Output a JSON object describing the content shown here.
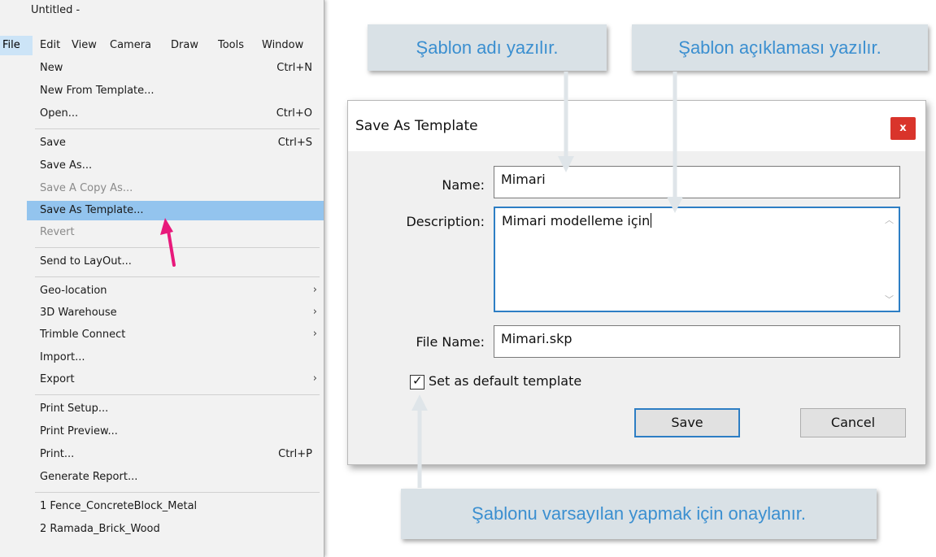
{
  "window": {
    "title": "Untitled -"
  },
  "menubar": [
    "File",
    "Edit",
    "View",
    "Camera",
    "Draw",
    "Tools",
    "Window"
  ],
  "file_menu": [
    {
      "label": "New",
      "shortcut": "Ctrl+N"
    },
    {
      "label": "New From Template...",
      "shortcut": ""
    },
    {
      "label": "Open...",
      "shortcut": "Ctrl+O"
    },
    {
      "label": "Save",
      "shortcut": "Ctrl+S"
    },
    {
      "label": "Save As...",
      "shortcut": ""
    },
    {
      "label": "Save A Copy As...",
      "shortcut": ""
    },
    {
      "label": "Save As Template...",
      "shortcut": ""
    },
    {
      "label": "Revert",
      "shortcut": ""
    },
    {
      "label": "Send to LayOut...",
      "shortcut": ""
    },
    {
      "label": "Geo-location",
      "shortcut": ""
    },
    {
      "label": "3D Warehouse",
      "shortcut": ""
    },
    {
      "label": "Trimble Connect",
      "shortcut": ""
    },
    {
      "label": "Import...",
      "shortcut": ""
    },
    {
      "label": "Export",
      "shortcut": ""
    },
    {
      "label": "Print Setup...",
      "shortcut": ""
    },
    {
      "label": "Print Preview...",
      "shortcut": ""
    },
    {
      "label": "Print...",
      "shortcut": "Ctrl+P"
    },
    {
      "label": "Generate Report...",
      "shortcut": ""
    },
    {
      "label": "1 Fence_ConcreteBlock_Metal",
      "shortcut": ""
    },
    {
      "label": "2 Ramada_Brick_Wood",
      "shortcut": ""
    }
  ],
  "dialog": {
    "title": "Save As Template",
    "close_label": "x",
    "name_label": "Name:",
    "name_value": "Mimari",
    "description_label": "Description:",
    "description_value": "Mimari modelleme için",
    "filename_label": "File Name:",
    "filename_value": "Mimari.skp",
    "default_checkbox_label": "Set as default template",
    "default_checked": true,
    "save_label": "Save",
    "cancel_label": "Cancel"
  },
  "callouts": {
    "name": "Şablon adı yazılır.",
    "description": "Şablon açıklaması yazılır.",
    "checkbox": "Şablonu varsayılan yapmak için onaylanır."
  },
  "colors": {
    "callout_text": "#3b8fd0",
    "callout_bg": "#d9e1e6",
    "pointer_arrow": "#e8197b",
    "selection": "#93c4ee",
    "close_button": "#d9342b"
  }
}
